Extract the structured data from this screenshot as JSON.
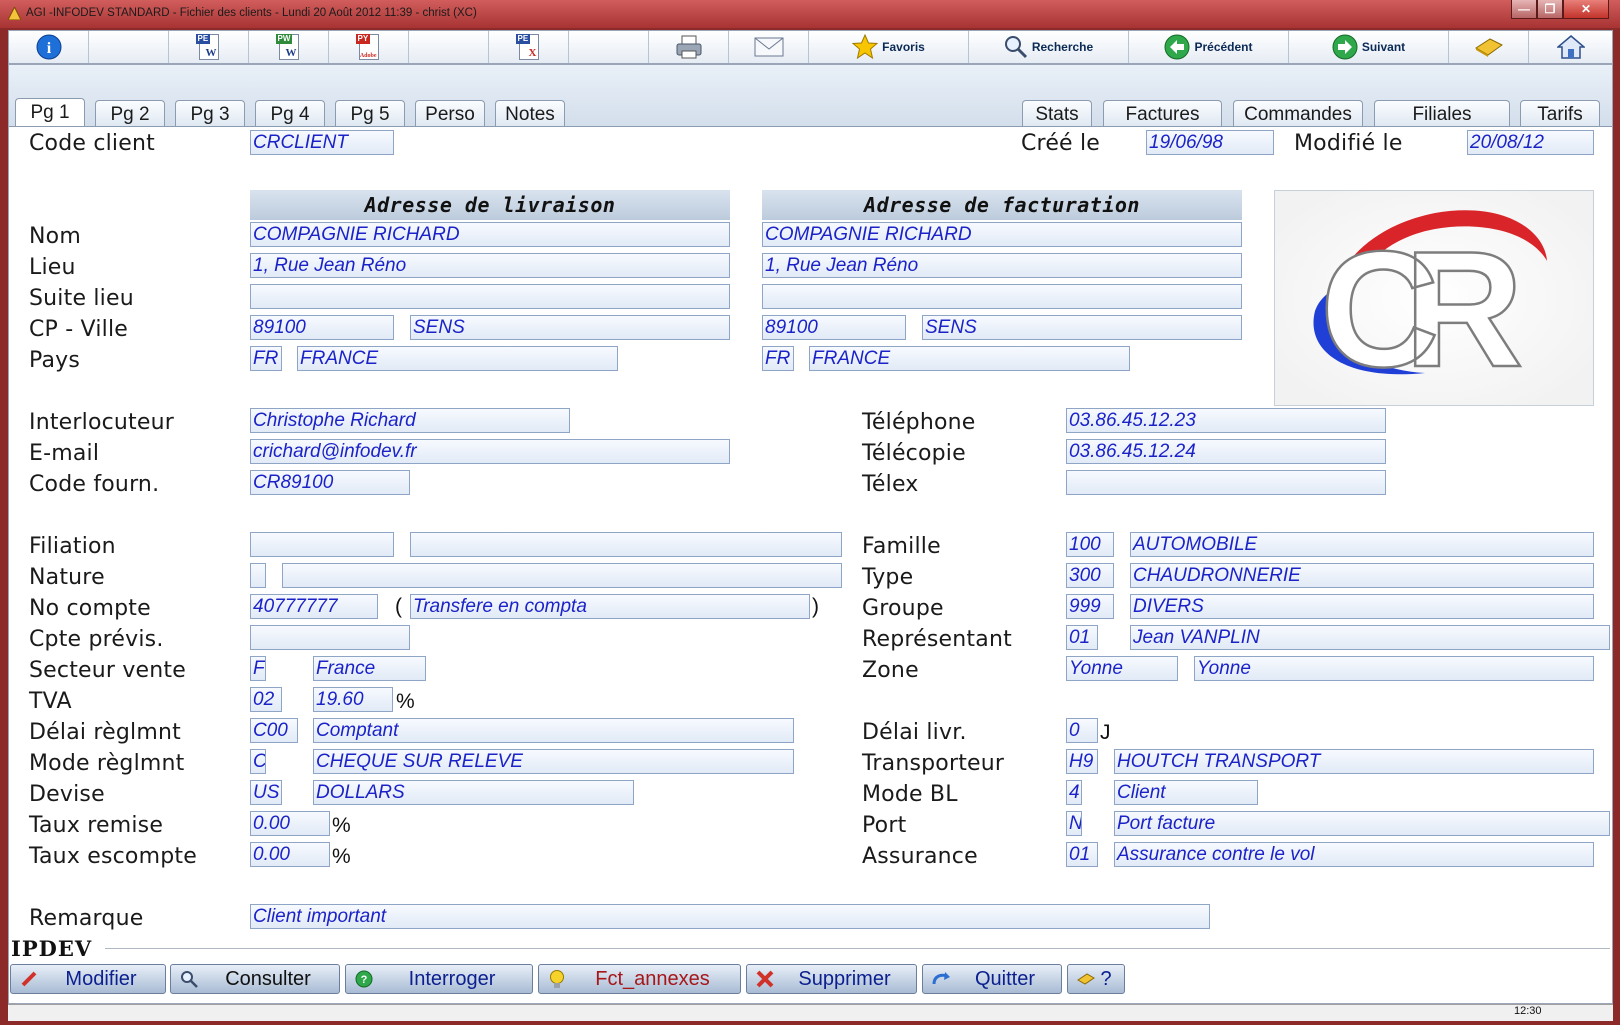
{
  "window": {
    "title": "AGI -INFODEV STANDARD - Fichier des clients - Lundi 20 Août 2012 11:39 - christ (XC)",
    "controls": [
      "—",
      "❐",
      "✕"
    ]
  },
  "toolbar": {
    "info_glyph": "i",
    "pe_word": "PE",
    "pw_word": "PW",
    "py_pdf": "PY",
    "pe_excel": "PE",
    "word_glyph": "W",
    "pdf_glyph": "Adobe",
    "excel_glyph": "X",
    "favoris": "Favoris",
    "recherche": "Recherche",
    "precedent": "Précédent",
    "suivant": "Suivant"
  },
  "tabs": {
    "left": [
      "Pg 1",
      "Pg 2",
      "Pg 3",
      "Pg 4",
      "Pg 5",
      "Perso",
      "Notes"
    ],
    "right": [
      "Stats",
      "Factures",
      "Commandes",
      "Filiales",
      "Tarifs"
    ]
  },
  "header": {
    "code_client_label": "Code client",
    "code_client": "CRCLIENT",
    "cree_label": "Créé le",
    "cree": "19/06/98",
    "modifie_label": "Modifié le",
    "modifie": "20/08/12"
  },
  "address": {
    "livraison_title": "Adresse de livraison",
    "facturation_title": "Adresse de facturation",
    "labels": {
      "nom": "Nom",
      "lieu": "Lieu",
      "suite": "Suite lieu",
      "cp_ville": "CP - Ville",
      "pays": "Pays"
    },
    "livraison": {
      "nom": "COMPAGNIE RICHARD",
      "lieu": "1, Rue Jean Réno",
      "suite": "",
      "cp": "89100",
      "ville": "SENS",
      "pays_code": "FR",
      "pays": "FRANCE"
    },
    "facturation": {
      "nom": "COMPAGNIE RICHARD",
      "lieu": "1, Rue Jean Réno",
      "suite": "",
      "cp": "89100",
      "ville": "SENS",
      "pays_code": "FR",
      "pays": "FRANCE"
    }
  },
  "logo": {
    "text": "CR",
    "colors": {
      "red": "#d9252a",
      "blue": "#1f3fd6",
      "outline": "#8a8a8a"
    }
  },
  "contact": {
    "labels": {
      "interlocuteur": "Interlocuteur",
      "email": "E-mail",
      "code_fourn": "Code fourn.",
      "telephone": "Téléphone",
      "telecopie": "Télécopie",
      "telex": "Télex"
    },
    "interlocuteur": "Christophe Richard",
    "email": "crichard@infodev.fr",
    "code_fourn": "CR89100",
    "telephone": "03.86.45.12.23",
    "telecopie": "03.86.45.12.24",
    "telex": ""
  },
  "left_block": {
    "labels": {
      "filiation": "Filiation",
      "nature": "Nature",
      "no_compte": "No compte",
      "cpte_previs": "Cpte prévis.",
      "secteur": "Secteur vente",
      "tva": "TVA",
      "delai_regl": "Délai règlmnt",
      "mode_regl": "Mode règlmnt",
      "devise": "Devise",
      "taux_remise": "Taux remise",
      "taux_escompte": "Taux escompte"
    },
    "filiation_code": "",
    "filiation_name": "",
    "nature_code": "",
    "nature_name": "",
    "no_compte": "40777777",
    "no_compte_paren_open": "(",
    "no_compte_status": "Transfere en compta",
    "no_compte_paren_close": ")",
    "cpte_previs": "",
    "secteur_code": "F",
    "secteur_name": "France",
    "tva_code": "02",
    "tva_rate": "19.60",
    "percent": "%",
    "delai_code": "C00",
    "delai_name": "Comptant",
    "mode_code": "C",
    "mode_name": "CHEQUE SUR RELEVE",
    "devise_code": "US",
    "devise_name": "DOLLARS",
    "taux_remise": "0.00",
    "taux_escompte": "0.00"
  },
  "right_block": {
    "labels": {
      "famille": "Famille",
      "type": "Type",
      "groupe": "Groupe",
      "representant": "Représentant",
      "zone": "Zone",
      "delai_livr": "Délai livr.",
      "transporteur": "Transporteur",
      "mode_bl": "Mode BL",
      "port": "Port",
      "assurance": "Assurance"
    },
    "famille_code": "100",
    "famille_name": "AUTOMOBILE",
    "type_code": "300",
    "type_name": "CHAUDRONNERIE",
    "groupe_code": "999",
    "groupe_name": "DIVERS",
    "rep_code": "01",
    "rep_name": "Jean VANPLIN",
    "zone_code": "Yonne",
    "zone_name": "Yonne",
    "delai_livr": "0",
    "delai_unit": "J",
    "transp_code": "H9",
    "transp_name": "HOUTCH TRANSPORT",
    "mode_bl_code": "4",
    "mode_bl_name": "Client",
    "port_code": "N",
    "port_name": "Port facture",
    "assurance_code": "01",
    "assurance_name": "Assurance contre le vol"
  },
  "remarque": {
    "label": "Remarque",
    "value": "Client important"
  },
  "footer": {
    "brand": "IPDEV",
    "buttons": {
      "modifier": "Modifier",
      "consulter": "Consulter",
      "interroger": "Interroger",
      "fct_annexes": "Fct_annexes",
      "supprimer": "Supprimer",
      "quitter": "Quitter",
      "help": "?"
    },
    "clock": "12:30"
  }
}
